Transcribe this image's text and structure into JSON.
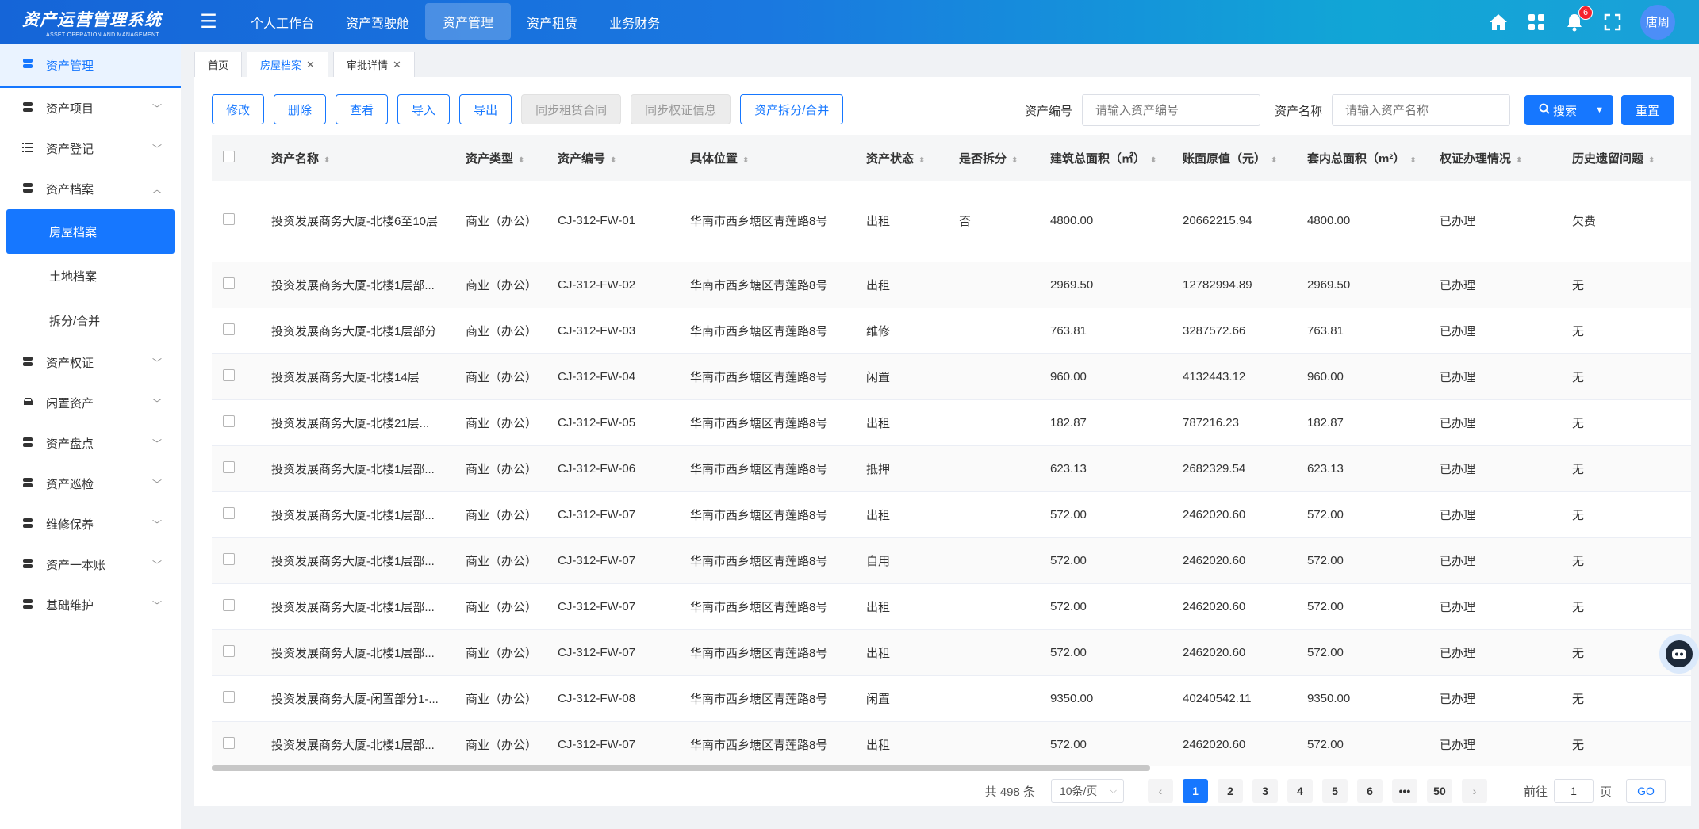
{
  "app": {
    "title": "资产运营管理系统",
    "subtitle": "ASSET OPERATION AND MANAGEMENT"
  },
  "topnav": [
    {
      "label": "个人工作台",
      "active": false
    },
    {
      "label": "资产驾驶舱",
      "active": false
    },
    {
      "label": "资产管理",
      "active": true
    },
    {
      "label": "资产租赁",
      "active": false
    },
    {
      "label": "业务财务",
      "active": false
    }
  ],
  "header_right": {
    "notification_count": "6",
    "user": "唐周"
  },
  "sidebar": {
    "head": "资产管理",
    "items": [
      {
        "label": "资产项目",
        "icon": "database-icon"
      },
      {
        "label": "资产登记",
        "icon": "list-icon"
      },
      {
        "label": "资产档案",
        "icon": "database-icon",
        "expanded": true,
        "children": [
          "房屋档案",
          "土地档案",
          "拆分/合并"
        ]
      },
      {
        "label": "资产权证",
        "icon": "database-icon"
      },
      {
        "label": "闲置资产",
        "icon": "car-icon"
      },
      {
        "label": "资产盘点",
        "icon": "database-icon"
      },
      {
        "label": "资产巡检",
        "icon": "database-icon"
      },
      {
        "label": "维修保养",
        "icon": "database-icon"
      },
      {
        "label": "资产一本账",
        "icon": "database-icon"
      },
      {
        "label": "基础维护",
        "icon": "database-icon"
      }
    ],
    "active_sub": "房屋档案"
  },
  "tabs": [
    {
      "label": "首页",
      "closable": false,
      "active": false
    },
    {
      "label": "房屋档案",
      "closable": true,
      "active": true
    },
    {
      "label": "审批详情",
      "closable": true,
      "active": false
    }
  ],
  "toolbar": {
    "edit": "修改",
    "delete": "删除",
    "view": "查看",
    "import": "导入",
    "export": "导出",
    "sync_lease": "同步租赁合同",
    "sync_cert": "同步权证信息",
    "split_merge": "资产拆分/合并"
  },
  "filters": {
    "code_label": "资产编号",
    "code_placeholder": "请输入资产编号",
    "name_label": "资产名称",
    "name_placeholder": "请输入资产名称",
    "search": "搜索",
    "reset": "重置"
  },
  "table": {
    "columns": [
      "资产名称",
      "资产类型",
      "资产编号",
      "具体位置",
      "资产状态",
      "是否拆分",
      "建筑总面积（㎡）",
      "账面原值（元）",
      "套内总面积（m²）",
      "权证办理情况",
      "历史遗留问题"
    ],
    "rows": [
      [
        "投资发展商务大厦-北楼6至10层",
        "商业（办公）",
        "CJ-312-FW-01",
        "华南市西乡塘区青莲路8号",
        "出租",
        "否",
        "4800.00",
        "20662215.94",
        "4800.00",
        "已办理",
        "欠费"
      ],
      [
        "投资发展商务大厦-北楼1层部...",
        "商业（办公）",
        "CJ-312-FW-02",
        "华南市西乡塘区青莲路8号",
        "出租",
        "",
        "2969.50",
        "12782994.89",
        "2969.50",
        "已办理",
        "无"
      ],
      [
        "投资发展商务大厦-北楼1层部分",
        "商业（办公）",
        "CJ-312-FW-03",
        "华南市西乡塘区青莲路8号",
        "维修",
        "",
        "763.81",
        "3287572.66",
        "763.81",
        "已办理",
        "无"
      ],
      [
        "投资发展商务大厦-北楼14层",
        "商业（办公）",
        "CJ-312-FW-04",
        "华南市西乡塘区青莲路8号",
        "闲置",
        "",
        "960.00",
        "4132443.12",
        "960.00",
        "已办理",
        "无"
      ],
      [
        "投资发展商务大厦-北楼21层...",
        "商业（办公）",
        "CJ-312-FW-05",
        "华南市西乡塘区青莲路8号",
        "出租",
        "",
        "182.87",
        "787216.23",
        "182.87",
        "已办理",
        "无"
      ],
      [
        "投资发展商务大厦-北楼1层部...",
        "商业（办公）",
        "CJ-312-FW-06",
        "华南市西乡塘区青莲路8号",
        "抵押",
        "",
        "623.13",
        "2682329.54",
        "623.13",
        "已办理",
        "无"
      ],
      [
        "投资发展商务大厦-北楼1层部...",
        "商业（办公）",
        "CJ-312-FW-07",
        "华南市西乡塘区青莲路8号",
        "出租",
        "",
        "572.00",
        "2462020.60",
        "572.00",
        "已办理",
        "无"
      ],
      [
        "投资发展商务大厦-北楼1层部...",
        "商业（办公）",
        "CJ-312-FW-07",
        "华南市西乡塘区青莲路8号",
        "自用",
        "",
        "572.00",
        "2462020.60",
        "572.00",
        "已办理",
        "无"
      ],
      [
        "投资发展商务大厦-北楼1层部...",
        "商业（办公）",
        "CJ-312-FW-07",
        "华南市西乡塘区青莲路8号",
        "出租",
        "",
        "572.00",
        "2462020.60",
        "572.00",
        "已办理",
        "无"
      ],
      [
        "投资发展商务大厦-北楼1层部...",
        "商业（办公）",
        "CJ-312-FW-07",
        "华南市西乡塘区青莲路8号",
        "出租",
        "",
        "572.00",
        "2462020.60",
        "572.00",
        "已办理",
        "无"
      ],
      [
        "投资发展商务大厦-闲置部分1-...",
        "商业（办公）",
        "CJ-312-FW-08",
        "华南市西乡塘区青莲路8号",
        "闲置",
        "",
        "9350.00",
        "40240542.11",
        "9350.00",
        "已办理",
        "无"
      ],
      [
        "投资发展商务大厦-北楼1层部...",
        "商业（办公）",
        "CJ-312-FW-07",
        "华南市西乡塘区青莲路8号",
        "出租",
        "",
        "572.00",
        "2462020.60",
        "572.00",
        "已办理",
        "无"
      ]
    ]
  },
  "pagination": {
    "total": "共 498 条",
    "page_size": "10条/页",
    "pages": [
      "1",
      "2",
      "3",
      "4",
      "5",
      "6",
      "•••",
      "50"
    ],
    "current": "1",
    "goto_label": "前往",
    "goto_value": "1",
    "page_unit": "页",
    "go": "GO"
  }
}
